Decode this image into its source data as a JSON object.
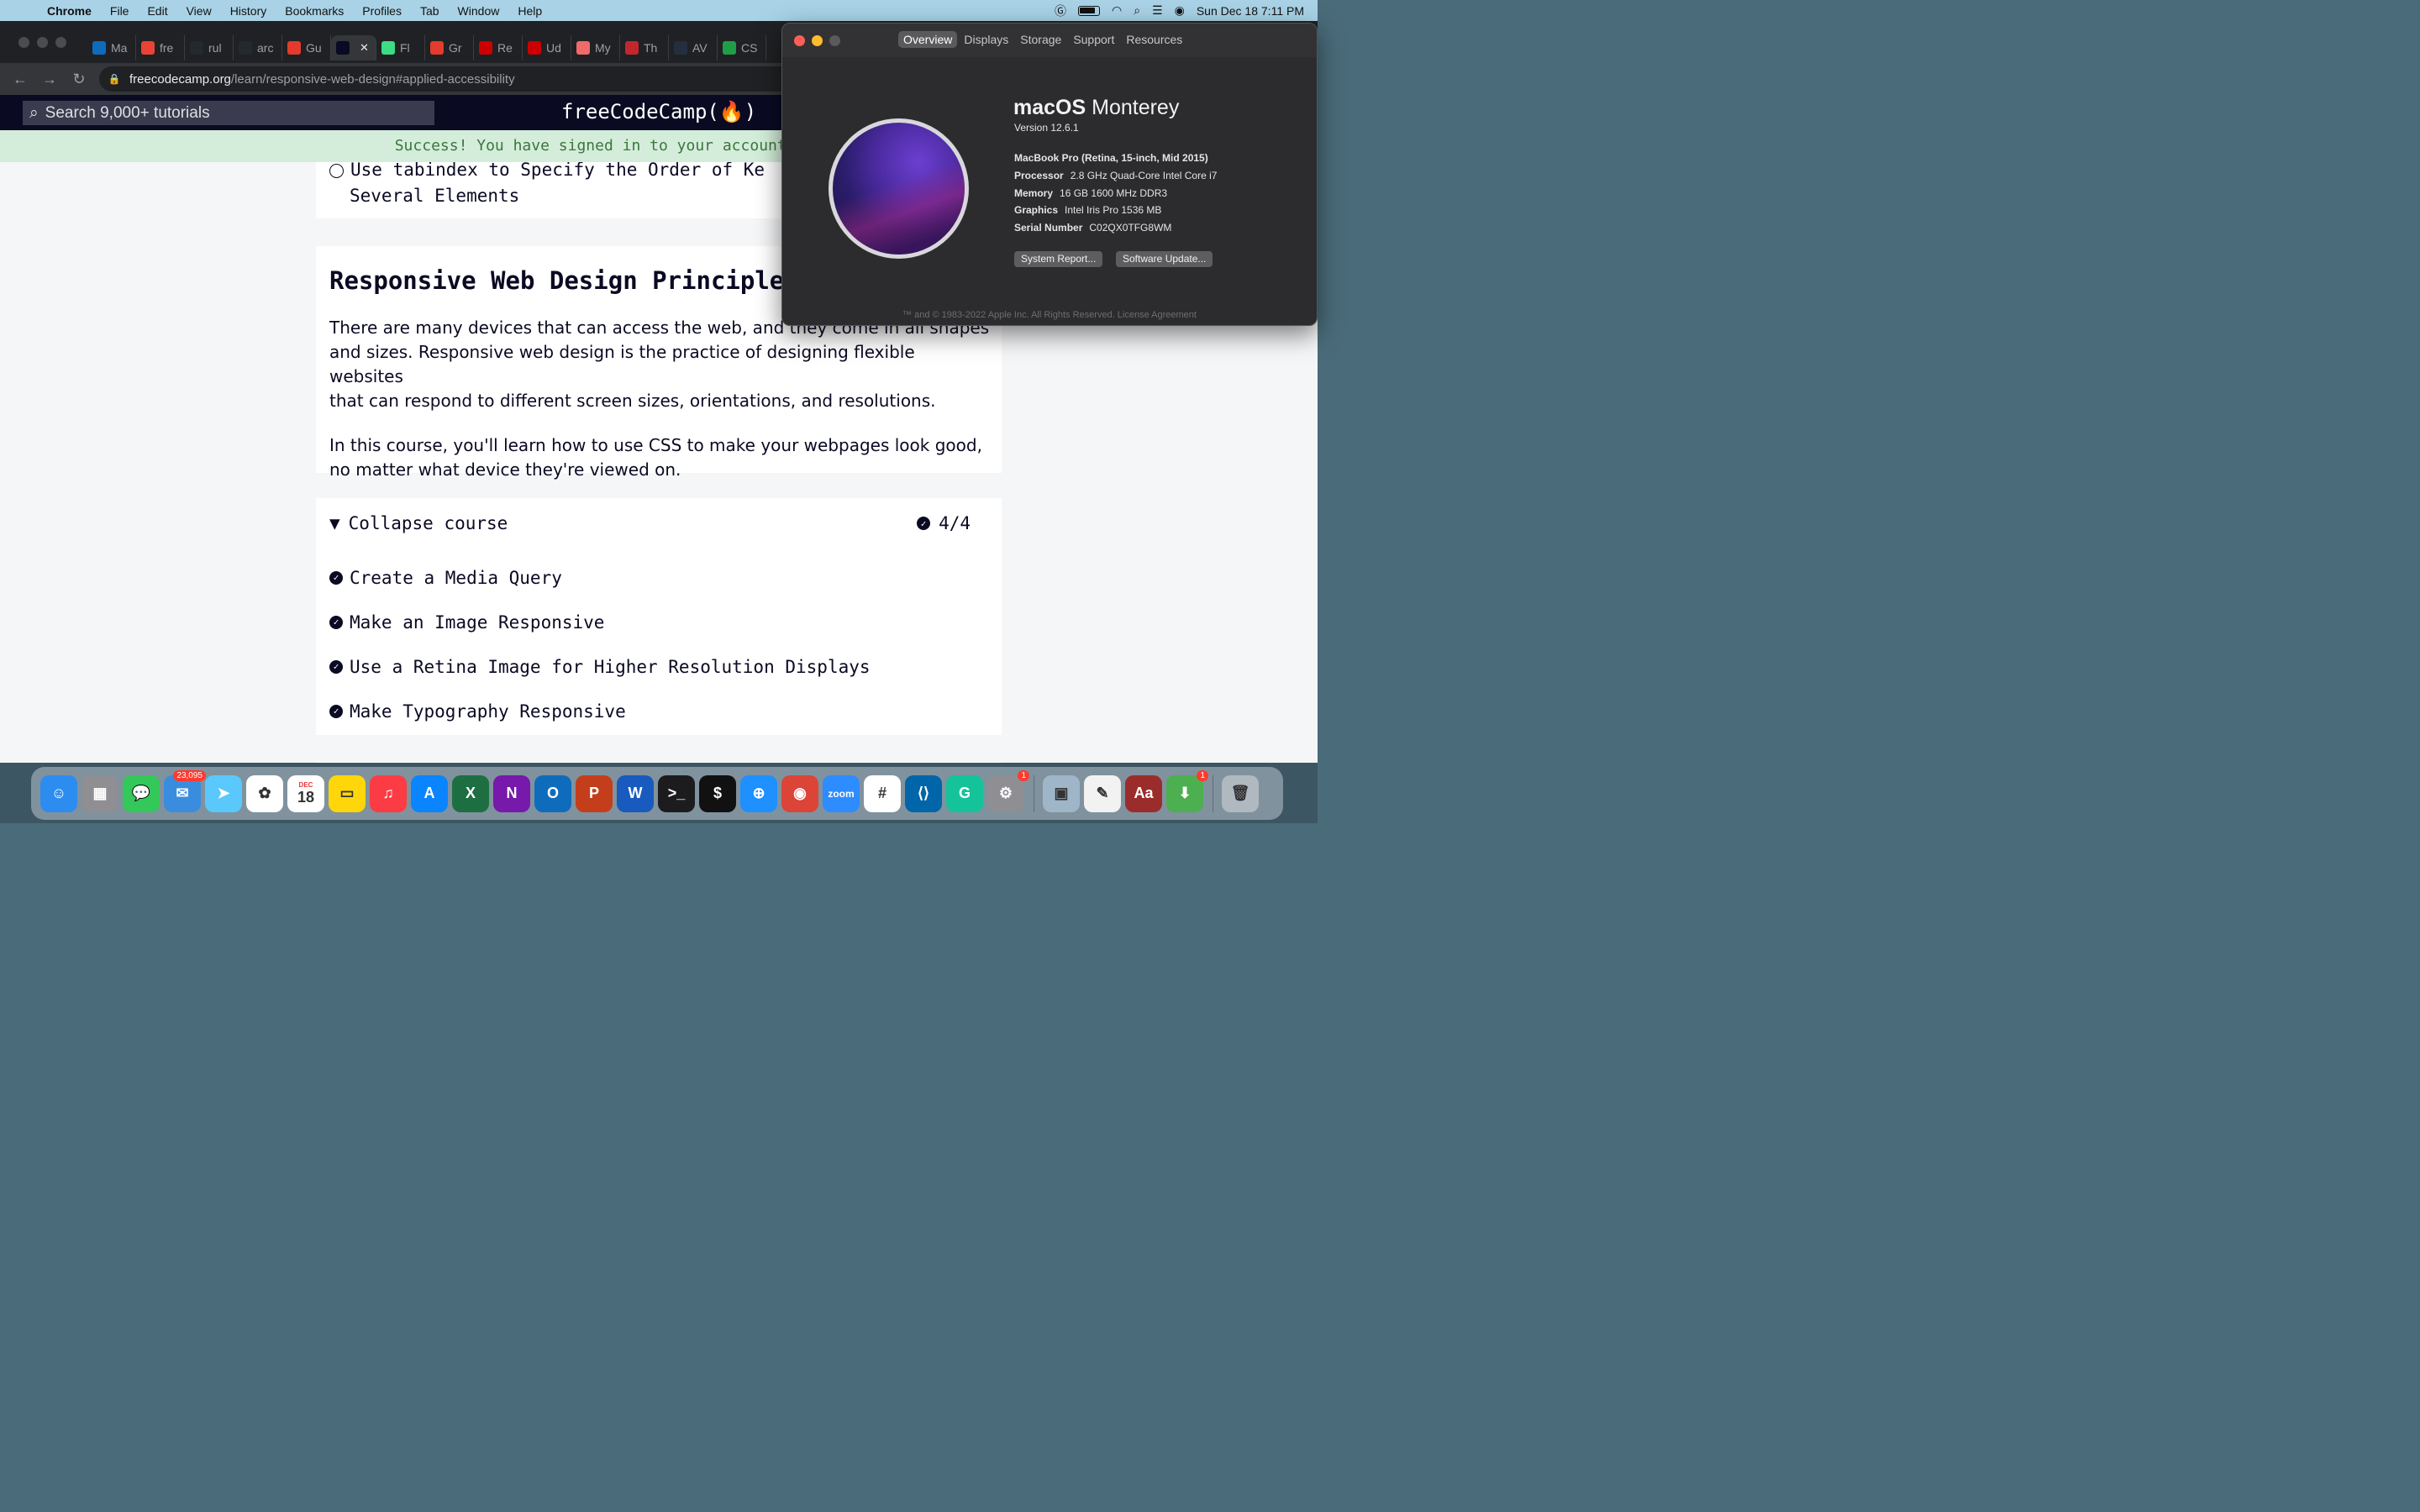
{
  "menubar": {
    "app_name": "Chrome",
    "items": [
      "File",
      "Edit",
      "View",
      "History",
      "Bookmarks",
      "Profiles",
      "Tab",
      "Window",
      "Help"
    ],
    "datetime": "Sun Dec 18  7:11 PM"
  },
  "browser": {
    "tabs": [
      {
        "label": "Ma",
        "icon": "outlook-icon",
        "color": "#0f6cbd"
      },
      {
        "label": "fre",
        "icon": "gmail-icon",
        "color": "#ea4335"
      },
      {
        "label": "rul",
        "icon": "github-icon",
        "color": "#24292e"
      },
      {
        "label": "arc",
        "icon": "github-icon",
        "color": "#24292e"
      },
      {
        "label": "Gu",
        "icon": "radial-icon",
        "color": "#e33b2e"
      },
      {
        "label": "",
        "icon": "freecodecamp-icon",
        "color": "#0a0a23",
        "active": true
      },
      {
        "label": "Fl",
        "icon": "android-icon",
        "color": "#3ddc84"
      },
      {
        "label": "Gr",
        "icon": "radial-icon",
        "color": "#e33b2e"
      },
      {
        "label": "Re",
        "icon": "rails-icon",
        "color": "#cc0000"
      },
      {
        "label": "Ud",
        "icon": "rails-icon",
        "color": "#cc0000"
      },
      {
        "label": "My",
        "icon": "asana-icon",
        "color": "#f06a6a"
      },
      {
        "label": "Th",
        "icon": "rv-icon",
        "color": "#c1272d"
      },
      {
        "label": "AV",
        "icon": "aws-icon",
        "color": "#232f3e"
      },
      {
        "label": "CS",
        "icon": "w-icon",
        "color": "#1f9e48"
      }
    ],
    "url_host": "freecodecamp.org",
    "url_path": "/learn/responsive-web-design#applied-accessibility"
  },
  "fcc": {
    "search_placeholder": "Search 9,000+ tutorials",
    "logo": "freeCodeCamp(🔥)",
    "banner": "Success! You have signed in to your account. Happy Coding!",
    "prev_lesson": {
      "line1": "Use tabindex to Specify the Order of Ke",
      "line2": "Several Elements"
    },
    "section_title": "Responsive Web Design Principle",
    "para1_lines": [
      "There are many devices that can access the web, and they come in all shapes",
      "and sizes. Responsive web design is the practice of designing flexible websites",
      "that can respond to different screen sizes, orientations, and resolutions."
    ],
    "para2_lines": [
      "In this course, you'll learn how to use CSS to make your webpages look good,",
      "no matter what device they're viewed on."
    ],
    "collapse_label": "Collapse course",
    "progress": "4/4",
    "lessons": [
      "Create a Media Query",
      "Make an Image Responsive",
      "Use a Retina Image for Higher Resolution Displays",
      "Make Typography Responsive"
    ]
  },
  "about": {
    "tabs": [
      "Overview",
      "Displays",
      "Storage",
      "Support",
      "Resources"
    ],
    "active_tab": "Overview",
    "os_name_bold": "macOS",
    "os_name": "Monterey",
    "version": "Version 12.6.1",
    "model": "MacBook Pro (Retina, 15-inch, Mid 2015)",
    "specs": [
      {
        "k": "Processor",
        "v": "2.8 GHz Quad-Core Intel Core i7"
      },
      {
        "k": "Memory",
        "v": "16 GB 1600 MHz DDR3"
      },
      {
        "k": "Graphics",
        "v": "Intel Iris Pro 1536 MB"
      },
      {
        "k": "Serial Number",
        "v": "C02QX0TFG8WM"
      }
    ],
    "system_report_btn": "System Report...",
    "software_update_btn": "Software Update...",
    "legal": "™ and © 1983-2022 Apple Inc. All Rights Reserved. License Agreement"
  },
  "dock": {
    "apps": [
      {
        "name": "finder",
        "glyph": "☺",
        "color": "#2d8cf0"
      },
      {
        "name": "launchpad",
        "glyph": "▦",
        "color": "#8e8e93"
      },
      {
        "name": "messages",
        "glyph": "💬",
        "color": "#34c759"
      },
      {
        "name": "mail",
        "glyph": "✉",
        "color": "#3a8dde",
        "badge": "23,095"
      },
      {
        "name": "maps",
        "glyph": "➤",
        "color": "#5ac8fa"
      },
      {
        "name": "photos",
        "glyph": "✿",
        "color": "#ffffff"
      },
      {
        "name": "calendar",
        "glyph": "18",
        "color": "#ffffff",
        "sub": "DEC"
      },
      {
        "name": "notes",
        "glyph": "▭",
        "color": "#ffd60a"
      },
      {
        "name": "music",
        "glyph": "♫",
        "color": "#fc3c44"
      },
      {
        "name": "app-store",
        "glyph": "A",
        "color": "#0a84ff"
      },
      {
        "name": "excel",
        "glyph": "X",
        "color": "#1d6f42"
      },
      {
        "name": "onenote",
        "glyph": "N",
        "color": "#7719aa"
      },
      {
        "name": "outlook",
        "glyph": "O",
        "color": "#0f6cbd"
      },
      {
        "name": "powerpoint",
        "glyph": "P",
        "color": "#c43e1c"
      },
      {
        "name": "word",
        "glyph": "W",
        "color": "#185abd"
      },
      {
        "name": "terminal",
        "glyph": ">_",
        "color": "#1c1c1e"
      },
      {
        "name": "iterm",
        "glyph": "$",
        "color": "#111111"
      },
      {
        "name": "safari",
        "glyph": "⊕",
        "color": "#1e90ff"
      },
      {
        "name": "chrome",
        "glyph": "◉",
        "color": "#db4437"
      },
      {
        "name": "zoom",
        "glyph": "zoom",
        "color": "#2d8cff"
      },
      {
        "name": "slack",
        "glyph": "#",
        "color": "#ffffff"
      },
      {
        "name": "vscode",
        "glyph": "⟨⟩",
        "color": "#0065a9"
      },
      {
        "name": "grammarly",
        "glyph": "G",
        "color": "#15c39a"
      },
      {
        "name": "system-preferences",
        "glyph": "⚙",
        "color": "#8e8e93",
        "badge": "1"
      },
      {
        "name": "preview",
        "glyph": "▣",
        "color": "#9fb6c8"
      },
      {
        "name": "textedit",
        "glyph": "✎",
        "color": "#f2f2f2"
      },
      {
        "name": "dictionary",
        "glyph": "Aa",
        "color": "#9b2c2c"
      },
      {
        "name": "archive-utility",
        "glyph": "⬇",
        "color": "#4caf50",
        "badge": "1"
      },
      {
        "name": "trash",
        "glyph": "🗑",
        "color": "#b0b8c0"
      }
    ]
  }
}
